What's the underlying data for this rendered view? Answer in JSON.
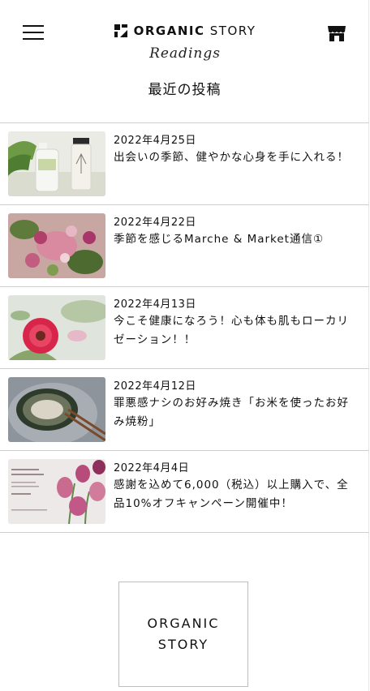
{
  "header": {
    "brand_name_bold": "ORGANIC",
    "brand_name_light": "STORY",
    "brand_sub": "Readings",
    "menu_icon": "hamburger-menu-icon",
    "shop_icon": "shop-icon"
  },
  "section_title": "最近の投稿",
  "posts": [
    {
      "date": "2022年4月25日",
      "title": "出会いの季節、健やかな心身を手に入れる！",
      "thumb": "product-bottles"
    },
    {
      "date": "2022年4月22日",
      "title": "季節を感じるMarche & Market通信①",
      "thumb": "flower-bouquet"
    },
    {
      "date": "2022年4月13日",
      "title": "今こそ健康になろう！心も体も肌もローカリゼーション！！",
      "thumb": "red-gerbera"
    },
    {
      "date": "2022年4月12日",
      "title": "罪悪感ナシのお好み焼き「お米を使ったお好み焼粉」",
      "thumb": "okonomiyaki"
    },
    {
      "date": "2022年4月4日",
      "title": "感謝を込めて6,000（税込）以上購入で、全品10%オフキャンペーン開催中！",
      "thumb": "tulip-campaign"
    }
  ],
  "footer": {
    "logo_line1": "ORGANIC",
    "logo_line2": "STORY"
  },
  "colors": {
    "text": "#111111",
    "divider": "#cfcfcf",
    "background": "#ffffff"
  }
}
